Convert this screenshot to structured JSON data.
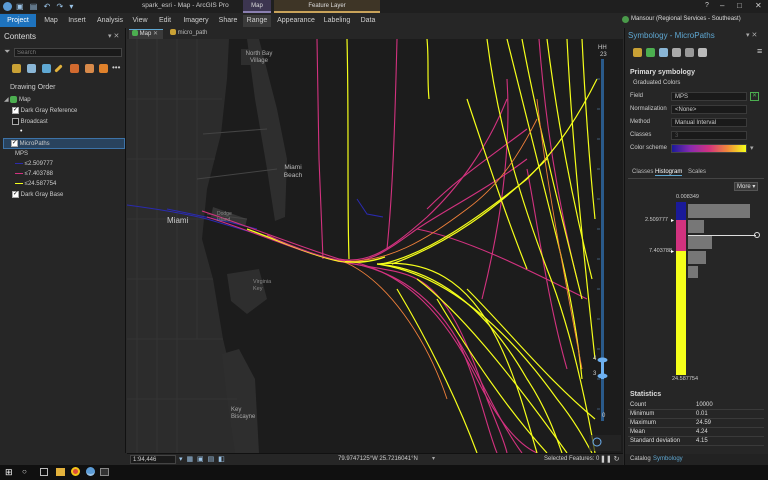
{
  "titlebar": {
    "title": "spark_esri - Map - ArcGIS Pro",
    "help": "?"
  },
  "ribbon": {
    "tabs": {
      "project": "Project",
      "map": "Map",
      "insert": "Insert",
      "analysis": "Analysis",
      "view": "View",
      "edit": "Edit",
      "imagery": "Imagery",
      "share": "Share",
      "range": "Range",
      "appearance": "Appearance",
      "labeling": "Labeling",
      "data": "Data"
    },
    "context_map": "Map",
    "context_layer": "Feature Layer",
    "user": "Mansour (Regional Services - Southeast)"
  },
  "contents": {
    "title": "Contents",
    "search_placeholder": "Search",
    "heading": "Drawing Order",
    "map": "Map",
    "dark_gray_reference": "Dark Gray Reference",
    "broadcast": "Broadcast",
    "micropaths": "MicroPaths",
    "field": "MPS",
    "class1": "≤2.509777",
    "class2": "≤7.403788",
    "class3": "≤24.587754",
    "dark_gray_base": "Dark Gray Base"
  },
  "map_tabs": {
    "tab1": "Map",
    "tab2": "micro_path"
  },
  "map_labels": {
    "north_bay": "North Bay\nVillage",
    "miami_beach": "Miami\nBeach",
    "miami": "Miami",
    "dodge": "Dodge\nIsland",
    "virginia": "Virginia\nKey",
    "key_biscayne": "Key\nBiscayne"
  },
  "time_slider": {
    "label": "HH",
    "top": "23",
    "bottom": "0",
    "upper_handle": "4",
    "lower_handle": "3"
  },
  "symbology": {
    "title": "Symbology - MicroPaths",
    "primary": "Primary symbology",
    "method_type": "Graduated Colors",
    "field_label": "Field",
    "field_value": "MPS",
    "normalization_label": "Normalization",
    "normalization_value": "<None>",
    "method_label": "Method",
    "method_value": "Manual Interval",
    "classes_label": "Classes",
    "classes_value": "3",
    "scheme_label": "Color scheme",
    "tabs": {
      "classes": "Classes",
      "histogram": "Histogram",
      "scales": "Scales"
    },
    "more": "More",
    "hist_min": "0.008349",
    "break1": "2.509777",
    "break2": "7.403788",
    "hist_max": "24.587754",
    "colors": {
      "c1": "#1a1a9a",
      "c2": "#d2327f",
      "c3": "#f5ff1a"
    }
  },
  "statistics": {
    "title": "Statistics",
    "rows": [
      {
        "k": "Count",
        "v": "10000"
      },
      {
        "k": "Minimum",
        "v": "0.01"
      },
      {
        "k": "Maximum",
        "v": "24.59"
      },
      {
        "k": "Mean",
        "v": "4.24"
      },
      {
        "k": "Standard deviation",
        "v": "4.15"
      }
    ]
  },
  "bottom_tabs": {
    "catalog": "Catalog",
    "symbology": "Symbology"
  },
  "statusbar": {
    "scale": "1:94,446",
    "coords": "79.9747125°W 25.7216041°N",
    "selected": "Selected Features: 0"
  }
}
